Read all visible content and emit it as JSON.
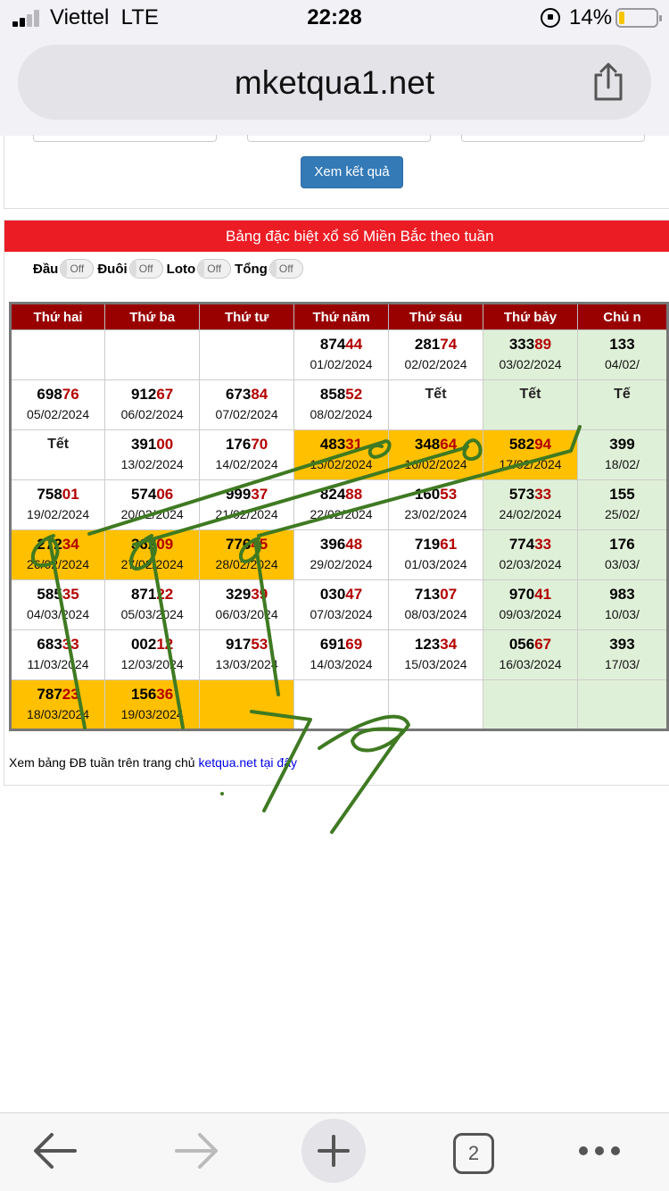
{
  "status_bar": {
    "carrier": "Viettel",
    "network": "LTE",
    "time": "22:28",
    "battery_percent": "14%",
    "battery_level": 0.14
  },
  "browser": {
    "url": "mketqua1.net",
    "tab_count": "2"
  },
  "form": {
    "submit_label": "Xem kết quả"
  },
  "panel": {
    "title": "Bảng đặc biệt xổ số Miền Bắc theo tuần",
    "toggles": [
      {
        "label": "Đầu",
        "state": "Off"
      },
      {
        "label": "Đuôi",
        "state": "Off"
      },
      {
        "label": "Loto",
        "state": "Off"
      },
      {
        "label": "Tổng",
        "state": "Off"
      }
    ]
  },
  "table": {
    "headers": [
      "Thứ hai",
      "Thứ ba",
      "Thứ tư",
      "Thứ năm",
      "Thứ sáu",
      "Thứ bảy",
      "Chủ n"
    ],
    "rows": [
      [
        {
          "empty": true
        },
        {
          "empty": true
        },
        {
          "empty": true
        },
        {
          "head": "874",
          "tail": "44",
          "date": "01/02/2024"
        },
        {
          "head": "281",
          "tail": "74",
          "date": "02/02/2024"
        },
        {
          "head": "333",
          "tail": "89",
          "date": "03/02/2024"
        },
        {
          "head": "133",
          "tail": "",
          "date": "04/02/"
        }
      ],
      [
        {
          "head": "698",
          "tail": "76",
          "date": "05/02/2024"
        },
        {
          "head": "912",
          "tail": "67",
          "date": "06/02/2024"
        },
        {
          "head": "673",
          "tail": "84",
          "date": "07/02/2024"
        },
        {
          "head": "858",
          "tail": "52",
          "date": "08/02/2024"
        },
        {
          "text": "Tết"
        },
        {
          "text": "Tết"
        },
        {
          "text": "Tế"
        }
      ],
      [
        {
          "text": "Tết"
        },
        {
          "head": "391",
          "tail": "00",
          "date": "13/02/2024"
        },
        {
          "head": "176",
          "tail": "70",
          "date": "14/02/2024"
        },
        {
          "head": "483",
          "tail": "31",
          "date": "15/02/2024",
          "hl": true
        },
        {
          "head": "348",
          "tail": "64",
          "date": "16/02/2024",
          "hl": true
        },
        {
          "head": "582",
          "tail": "94",
          "date": "17/02/2024",
          "hl": true
        },
        {
          "head": "399",
          "tail": "",
          "date": "18/02/"
        }
      ],
      [
        {
          "head": "758",
          "tail": "01",
          "date": "19/02/2024"
        },
        {
          "head": "574",
          "tail": "06",
          "date": "20/02/2024"
        },
        {
          "head": "999",
          "tail": "37",
          "date": "21/02/2024"
        },
        {
          "head": "824",
          "tail": "88",
          "date": "22/02/2024"
        },
        {
          "head": "160",
          "tail": "53",
          "date": "23/02/2024"
        },
        {
          "head": "573",
          "tail": "33",
          "date": "24/02/2024"
        },
        {
          "head": "155",
          "tail": "",
          "date": "25/02/"
        }
      ],
      [
        {
          "head": "272",
          "tail": "34",
          "date": "26/02/2024",
          "hl": true
        },
        {
          "head": "362",
          "tail": "09",
          "date": "27/02/2024",
          "hl": true
        },
        {
          "head": "776",
          "tail": "45",
          "date": "28/02/2024",
          "hl": true
        },
        {
          "head": "396",
          "tail": "48",
          "date": "29/02/2024"
        },
        {
          "head": "719",
          "tail": "61",
          "date": "01/03/2024"
        },
        {
          "head": "774",
          "tail": "33",
          "date": "02/03/2024"
        },
        {
          "head": "176",
          "tail": "",
          "date": "03/03/"
        }
      ],
      [
        {
          "head": "585",
          "tail": "35",
          "date": "04/03/2024"
        },
        {
          "head": "871",
          "tail": "22",
          "date": "05/03/2024"
        },
        {
          "head": "329",
          "tail": "39",
          "date": "06/03/2024"
        },
        {
          "head": "030",
          "tail": "47",
          "date": "07/03/2024"
        },
        {
          "head": "713",
          "tail": "07",
          "date": "08/03/2024"
        },
        {
          "head": "970",
          "tail": "41",
          "date": "09/03/2024"
        },
        {
          "head": "983",
          "tail": "",
          "date": "10/03/"
        }
      ],
      [
        {
          "head": "683",
          "tail": "33",
          "date": "11/03/2024"
        },
        {
          "head": "002",
          "tail": "12",
          "date": "12/03/2024"
        },
        {
          "head": "917",
          "tail": "53",
          "date": "13/03/2024"
        },
        {
          "head": "691",
          "tail": "69",
          "date": "14/03/2024"
        },
        {
          "head": "123",
          "tail": "34",
          "date": "15/03/2024"
        },
        {
          "head": "056",
          "tail": "67",
          "date": "16/03/2024"
        },
        {
          "head": "393",
          "tail": "",
          "date": "17/03/"
        }
      ],
      [
        {
          "head": "787",
          "tail": "23",
          "date": "18/03/2024",
          "hl": true
        },
        {
          "head": "156",
          "tail": "36",
          "date": "19/03/2024",
          "hl": true
        },
        {
          "empty": true,
          "hl": true
        },
        {
          "empty": true
        },
        {
          "empty": true
        },
        {
          "empty": true
        },
        {
          "empty": true
        }
      ]
    ]
  },
  "footer": {
    "text": "Xem bảng ĐB tuần trên trang chủ ",
    "link_text": "ketqua.net tại đây"
  },
  "colors": {
    "header_red": "#ec1c24",
    "th_dark_red": "#990000",
    "highlight": "#ffc000",
    "saturday_green": "#dff0d8",
    "button_blue": "#337ab7",
    "scribble_green": "#3f7a22"
  }
}
